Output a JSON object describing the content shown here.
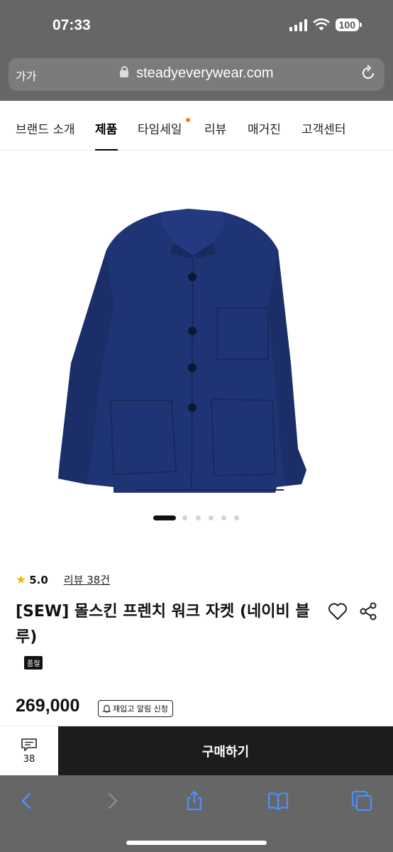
{
  "status": {
    "time": "07:33",
    "battery": "100"
  },
  "browser": {
    "text_size_label": "가가",
    "url": "steadyeverywear.com"
  },
  "nav": {
    "items": [
      {
        "label": "브랜드 소개"
      },
      {
        "label": "제품",
        "active": true
      },
      {
        "label": "타임세일",
        "has_dot": true
      },
      {
        "label": "리뷰"
      },
      {
        "label": "매거진"
      },
      {
        "label": "고객센터"
      }
    ]
  },
  "product": {
    "image_icon": "navy-work-jacket-image",
    "carousel": {
      "count": 6,
      "active_index": 0
    },
    "rating": "5.0",
    "review_link": "리뷰 38건",
    "title": "[SEW] 몰스킨 프렌치 워크 자켓 (네이비 블루)",
    "badge": "품절",
    "price": "269,000",
    "restock_label": "재입고 알림 신청"
  },
  "bottom_bar": {
    "review_count": "38",
    "buy_label": "구매하기"
  },
  "colors": {
    "accent_dot": "#ff7a1a",
    "jacket": "#1f3474",
    "star": "#f7b500"
  }
}
